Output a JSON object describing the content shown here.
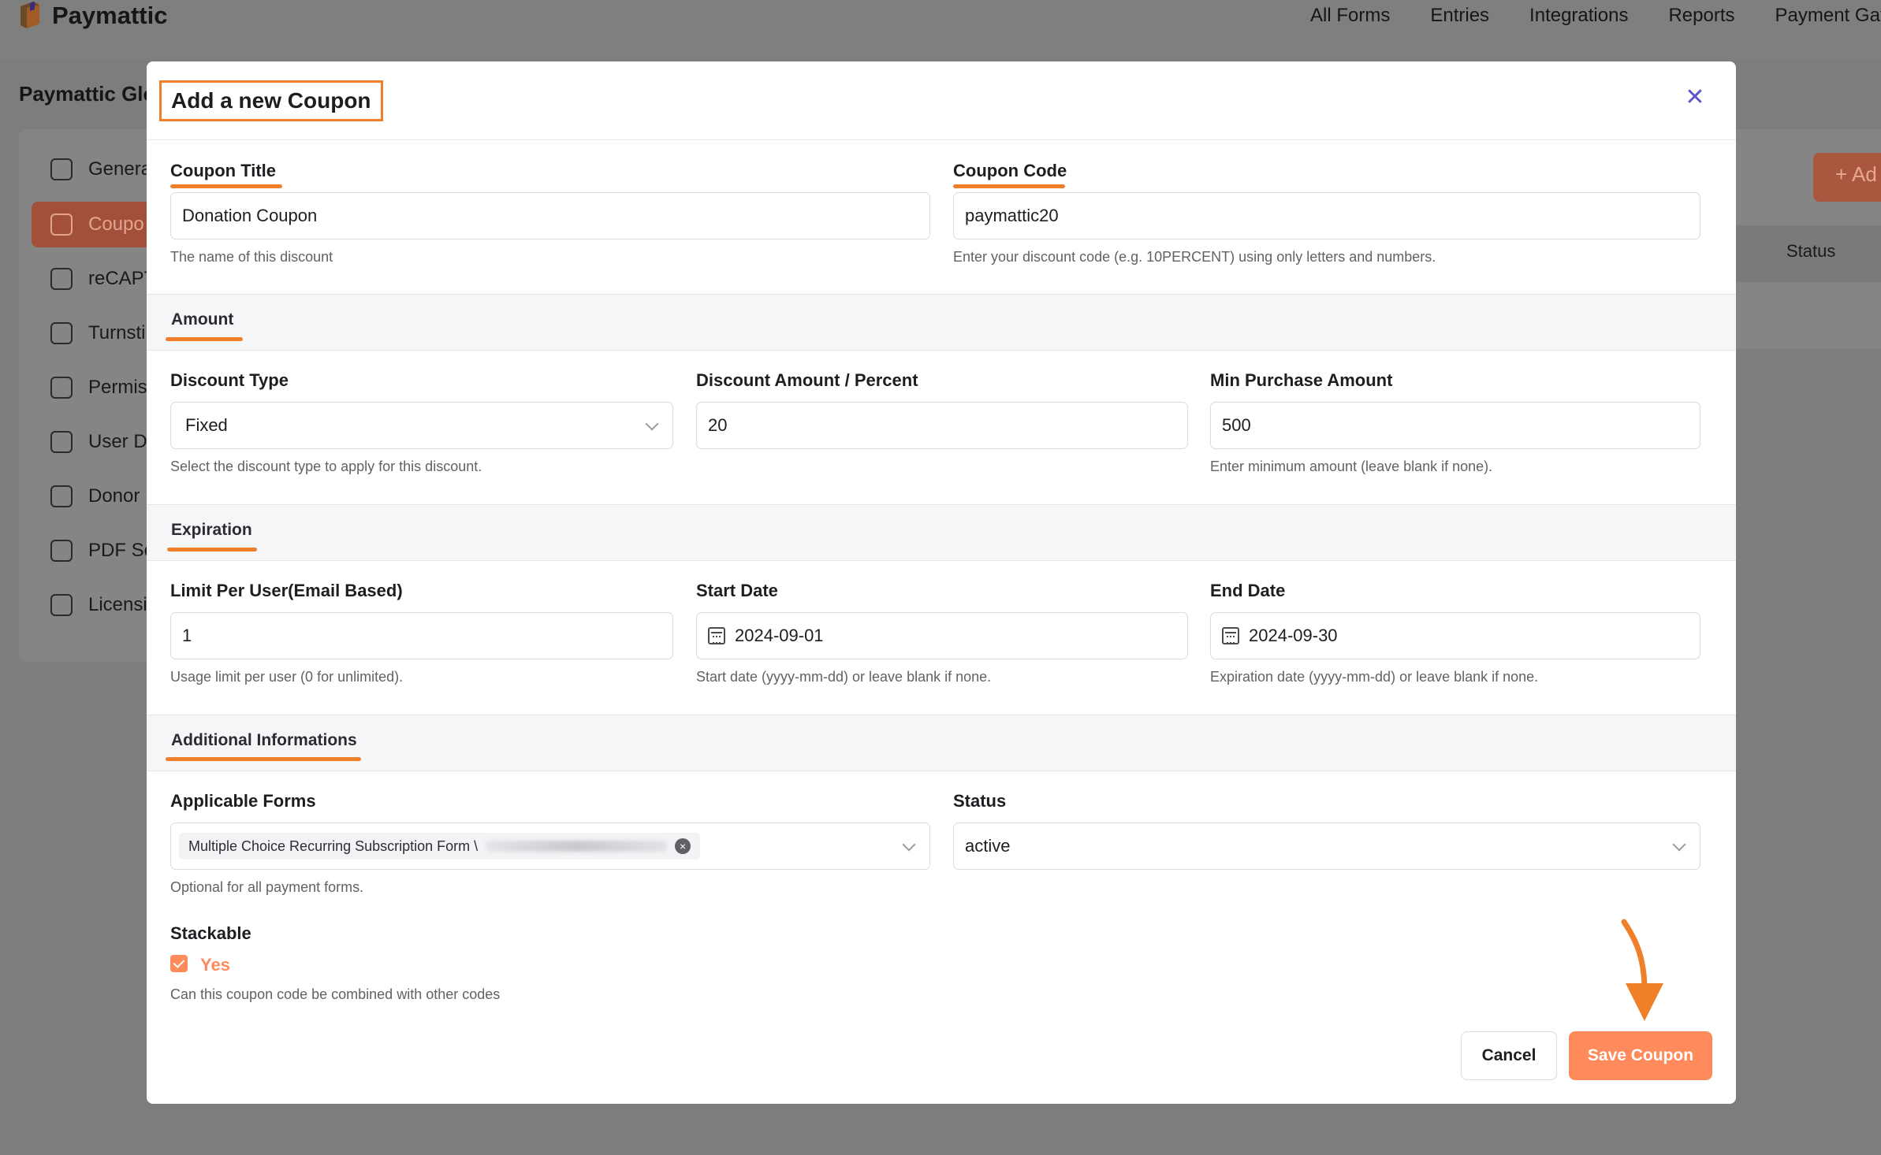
{
  "app": {
    "name": "Paymattic",
    "nav": [
      "All Forms",
      "Entries",
      "Integrations",
      "Reports",
      "Payment Gat"
    ]
  },
  "page": {
    "title": "Paymattic Glo",
    "sidebar": [
      "Genera",
      "Coupo",
      "reCAPT",
      "Turnsti",
      "Permis",
      "User D",
      "Donor I",
      "PDF Se",
      "Licensi"
    ],
    "add_button": "+ Ad",
    "table_status_col": "Status"
  },
  "modal": {
    "title": "Add a new Coupon",
    "close_icon": "close-icon",
    "coupon_title": {
      "label": "Coupon Title",
      "value": "Donation Coupon",
      "help": "The name of this discount"
    },
    "coupon_code": {
      "label": "Coupon Code",
      "value": "paymattic20",
      "help": "Enter your discount code (e.g. 10PERCENT) using only letters and numbers."
    },
    "section_amount": "Amount",
    "discount_type": {
      "label": "Discount Type",
      "value": "Fixed",
      "help": "Select the discount type to apply for this discount."
    },
    "discount_amount": {
      "label": "Discount Amount / Percent",
      "value": "20"
    },
    "min_purchase": {
      "label": "Min Purchase Amount",
      "value": "500",
      "help": "Enter minimum amount (leave blank if none)."
    },
    "section_expiration": "Expiration",
    "limit_per_user": {
      "label": "Limit Per User(Email Based)",
      "value": "1",
      "help": "Usage limit per user (0 for unlimited)."
    },
    "start_date": {
      "label": "Start Date",
      "value": "2024-09-01",
      "help": "Start date (yyyy-mm-dd) or leave blank if none."
    },
    "end_date": {
      "label": "End Date",
      "value": "2024-09-30",
      "help": "Expiration date (yyyy-mm-dd) or leave blank if none."
    },
    "section_additional": "Additional Informations",
    "applicable_forms": {
      "label": "Applicable Forms",
      "tag": "Multiple Choice Recurring Subscription Form \\",
      "help": "Optional for all payment forms."
    },
    "status": {
      "label": "Status",
      "value": "active"
    },
    "stackable": {
      "label": "Stackable",
      "option": "Yes",
      "help": "Can this coupon code be combined with other codes"
    },
    "cancel_label": "Cancel",
    "save_label": "Save Coupon"
  },
  "colors": {
    "accent": "#ff8a5c",
    "highlight": "#f07f2a"
  }
}
